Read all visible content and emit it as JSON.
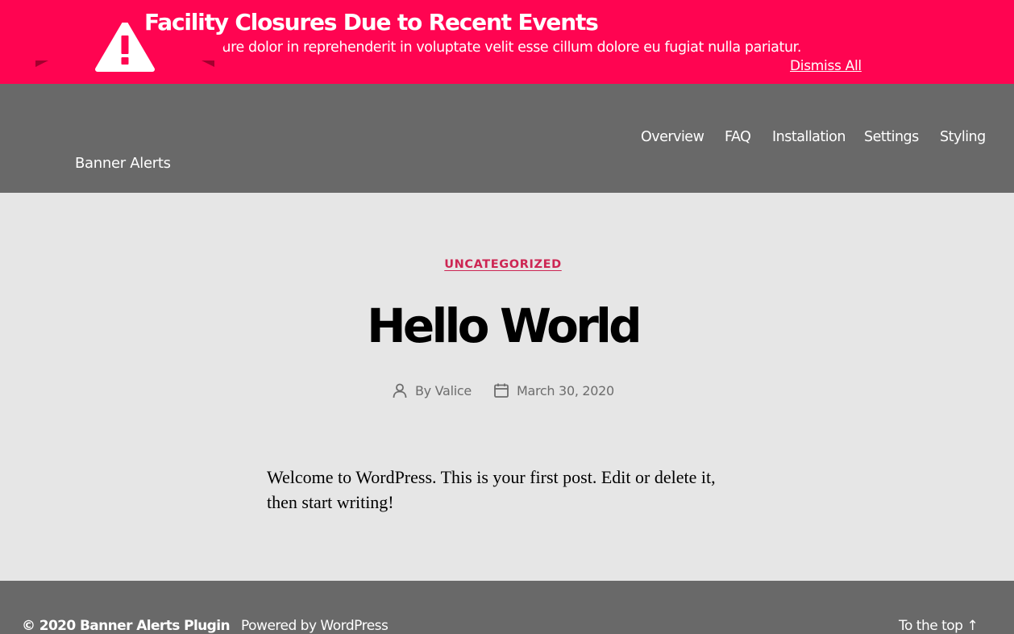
{
  "alert": {
    "title": "Facility Closures Due to Recent Events",
    "body": "Duis aute irure dolor in reprehenderit in voluptate velit esse cillum dolore eu fugiat nulla pariatur.",
    "dismiss_label": "Dismiss All",
    "background_color": "#ff0451"
  },
  "header": {
    "logo_text": "Banner Alerts",
    "logo_icon": "warning-triangle-ribbon-icon",
    "background_color": "#696969",
    "nav": [
      {
        "label": "Overview"
      },
      {
        "label": "FAQ"
      },
      {
        "label": "Installation"
      },
      {
        "label": "Settings"
      },
      {
        "label": "Styling"
      }
    ]
  },
  "post": {
    "category": "UNCATEGORIZED",
    "title": "Hello World",
    "author_prefix": "By",
    "author": "Valice",
    "author_icon": "user-icon",
    "date": "March 30, 2020",
    "date_icon": "calendar-icon",
    "body": "Welcome to WordPress. This is your first post. Edit or delete it, then start writing!",
    "accent_color": "#cd2653"
  },
  "footer": {
    "copyright": "© 2020 Banner Alerts Plugin",
    "powered_by": "Powered by WordPress",
    "to_top_label": "To the top",
    "to_top_arrow": "↑"
  }
}
